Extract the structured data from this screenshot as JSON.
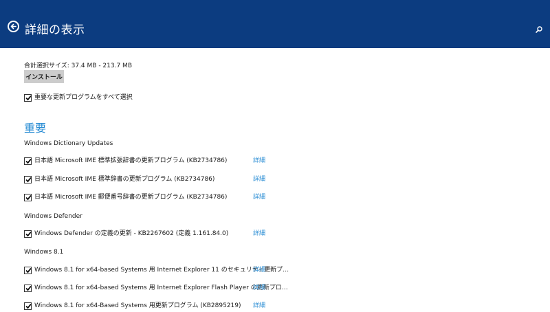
{
  "header": {
    "title": "詳細の表示",
    "back_icon": "back-arrow-icon",
    "search_icon": "search-icon",
    "background": "#0c3c80"
  },
  "summary": {
    "total_size": "合計選択サイズ: 37.4 MB - 213.7 MB",
    "install_label": "インストール"
  },
  "select_all": {
    "label": "重要な更新プログラムをすべて選択",
    "checked": true
  },
  "section": {
    "heading": "重要",
    "accent": "#2a8dd4"
  },
  "groups": [
    {
      "title": "Windows Dictionary Updates",
      "items": [
        {
          "label": "日本語 Microsoft IME 標準拡張辞書の更新プログラム (KB2734786)",
          "details": "詳細",
          "checked": true
        },
        {
          "label": "日本語 Microsoft IME 標準辞書の更新プログラム (KB2734786)",
          "details": "詳細",
          "checked": true
        },
        {
          "label": "日本語 Microsoft IME 郵便番号辞書の更新プログラム (KB2734786)",
          "details": "詳細",
          "checked": true
        }
      ]
    },
    {
      "title": "Windows Defender",
      "items": [
        {
          "label": "Windows Defender の定義の更新 - KB2267602 (定義 1.161.84.0)",
          "details": "詳細",
          "checked": true
        }
      ]
    },
    {
      "title": "Windows 8.1",
      "items": [
        {
          "label": "Windows 8.1 for x64-based Systems 用 Internet Explorer 11 のセキュリティ更新プ…",
          "details": "詳細",
          "checked": true
        },
        {
          "label": "Windows 8.1 for x64-based Systems 用 Internet Explorer Flash Player の更新プロ…",
          "details": "詳細",
          "checked": true
        },
        {
          "label": "Windows 8.1 for x64-Based Systems 用更新プログラム (KB2895219)",
          "details": "詳細",
          "checked": true
        }
      ]
    }
  ]
}
